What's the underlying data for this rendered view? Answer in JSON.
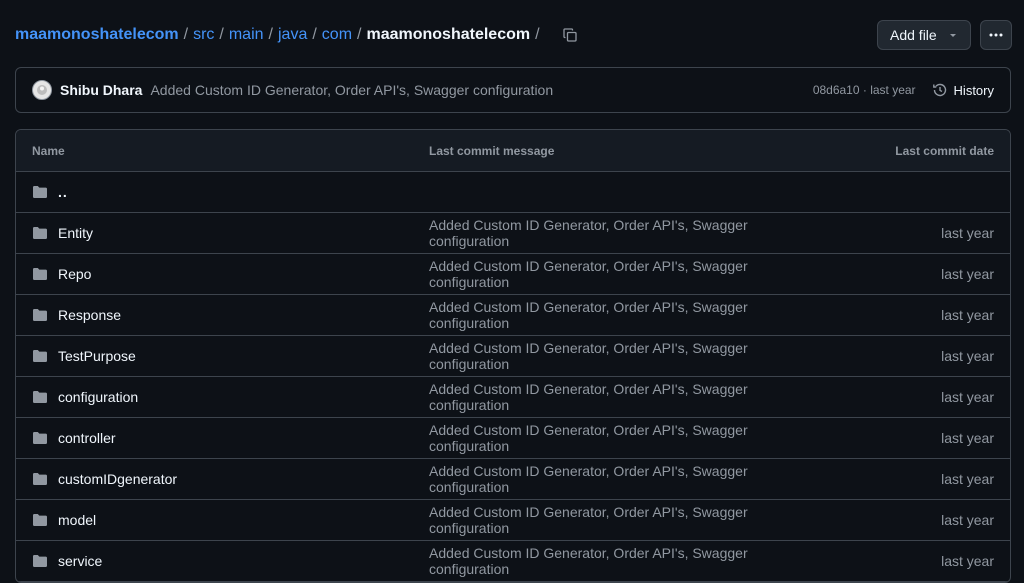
{
  "breadcrumb": {
    "repo": "maamonoshatelecom",
    "segments": [
      "src",
      "main",
      "java",
      "com"
    ],
    "current": "maamonoshatelecom",
    "separator": "/"
  },
  "header": {
    "add_file_label": "Add file",
    "more_label": "···"
  },
  "latest_commit": {
    "author": "Shibu Dhara",
    "message": "Added Custom ID Generator, Order API's, Swagger configuration",
    "sha_and_time": "08d6a10 · last year",
    "history_label": "History"
  },
  "table": {
    "headers": {
      "name": "Name",
      "message": "Last commit message",
      "date": "Last commit date"
    },
    "parent_label": "..",
    "rows": [
      {
        "name": "Entity",
        "message": "Added Custom ID Generator, Order API's, Swagger configuration",
        "date": "last year"
      },
      {
        "name": "Repo",
        "message": "Added Custom ID Generator, Order API's, Swagger configuration",
        "date": "last year"
      },
      {
        "name": "Response",
        "message": "Added Custom ID Generator, Order API's, Swagger configuration",
        "date": "last year"
      },
      {
        "name": "TestPurpose",
        "message": "Added Custom ID Generator, Order API's, Swagger configuration",
        "date": "last year"
      },
      {
        "name": "configuration",
        "message": "Added Custom ID Generator, Order API's, Swagger configuration",
        "date": "last year"
      },
      {
        "name": "controller",
        "message": "Added Custom ID Generator, Order API's, Swagger configuration",
        "date": "last year"
      },
      {
        "name": "customIDgenerator",
        "message": "Added Custom ID Generator, Order API's, Swagger configuration",
        "date": "last year"
      },
      {
        "name": "model",
        "message": "Added Custom ID Generator, Order API's, Swagger configuration",
        "date": "last year"
      },
      {
        "name": "service",
        "message": "Added Custom ID Generator, Order API's, Swagger configuration",
        "date": "last year"
      }
    ]
  },
  "colors": {
    "background": "#0d1117",
    "link": "#4493f8",
    "border": "#3d444d",
    "muted_text": "#9198a1",
    "folder_icon": "#9198a1"
  },
  "icons": {
    "copy": "copy-icon",
    "dropdown": "triangle-down-icon",
    "kebab": "kebab-horizontal-icon",
    "history": "history-icon",
    "folder": "folder-icon"
  }
}
